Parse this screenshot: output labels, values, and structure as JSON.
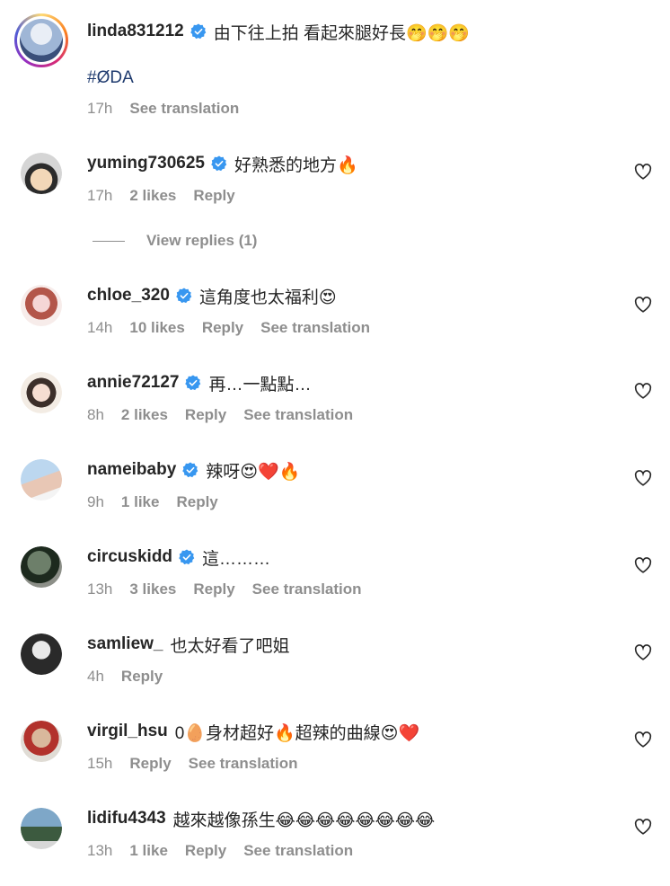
{
  "comments": [
    {
      "username": "linda831212",
      "verified": true,
      "text": "由下往上拍 看起來腿好長🤭🤭🤭",
      "hashtag": "#ØDA",
      "time": "17h",
      "likes": "",
      "reply": "",
      "translation": "See translation",
      "avatar_colors": [
        "#c9d9ec",
        "#3a4f7a"
      ],
      "is_post_author": true
    },
    {
      "username": "yuming730625",
      "verified": true,
      "text": "好熟悉的地方🔥",
      "time": "17h",
      "likes": "2 likes",
      "reply": "Reply",
      "translation": "",
      "avatar_colors": [
        "#f2d7b8",
        "#2b2b2b"
      ]
    },
    {
      "username": "chloe_320",
      "verified": true,
      "text": "這角度也太福利😍",
      "time": "14h",
      "likes": "10 likes",
      "reply": "Reply",
      "translation": "See translation",
      "avatar_colors": [
        "#f5d6d6",
        "#b3564a"
      ]
    },
    {
      "username": "annie72127",
      "verified": true,
      "text": "再…一點點…",
      "time": "8h",
      "likes": "2 likes",
      "reply": "Reply",
      "translation": "See translation",
      "avatar_colors": [
        "#f3ece4",
        "#3c2f2a"
      ]
    },
    {
      "username": "nameibaby",
      "verified": true,
      "text": "辣呀😍❤️🔥",
      "time": "9h",
      "likes": "1 like",
      "reply": "Reply",
      "translation": "",
      "avatar_colors": [
        "#bcd7ef",
        "#e8c7b5"
      ]
    },
    {
      "username": "circuskidd",
      "verified": true,
      "text": "這………",
      "time": "13h",
      "likes": "3 likes",
      "reply": "Reply",
      "translation": "See translation",
      "avatar_colors": [
        "#6d7f6a",
        "#1d2a1e"
      ]
    },
    {
      "username": "samliew_",
      "verified": false,
      "text": "也太好看了吧姐",
      "time": "4h",
      "likes": "",
      "reply": "Reply",
      "translation": "",
      "avatar_colors": [
        "#2a2a2a",
        "#e9e9e9"
      ]
    },
    {
      "username": "virgil_hsu",
      "verified": false,
      "text": "0🥚身材超好🔥超辣的曲線😍❤️",
      "time": "15h",
      "likes": "",
      "reply": "Reply",
      "translation": "See translation",
      "avatar_colors": [
        "#d9b89c",
        "#b2322c"
      ]
    },
    {
      "username": "lidifu4343",
      "verified": false,
      "text": "越來越像孫生😂😂😂😂😂😂😂😂",
      "time": "13h",
      "likes": "1 like",
      "reply": "Reply",
      "translation": "See translation",
      "avatar_colors": [
        "#7ea7c8",
        "#3c5a3f"
      ]
    }
  ],
  "view_replies": "View replies (1)",
  "colors": {
    "verified_badge": "#3897f0",
    "meta_text": "#8e8e8e",
    "hashtag": "#1e3a6e"
  },
  "icons": {
    "verified": "verified-badge-icon",
    "like": "heart-outline-icon"
  }
}
